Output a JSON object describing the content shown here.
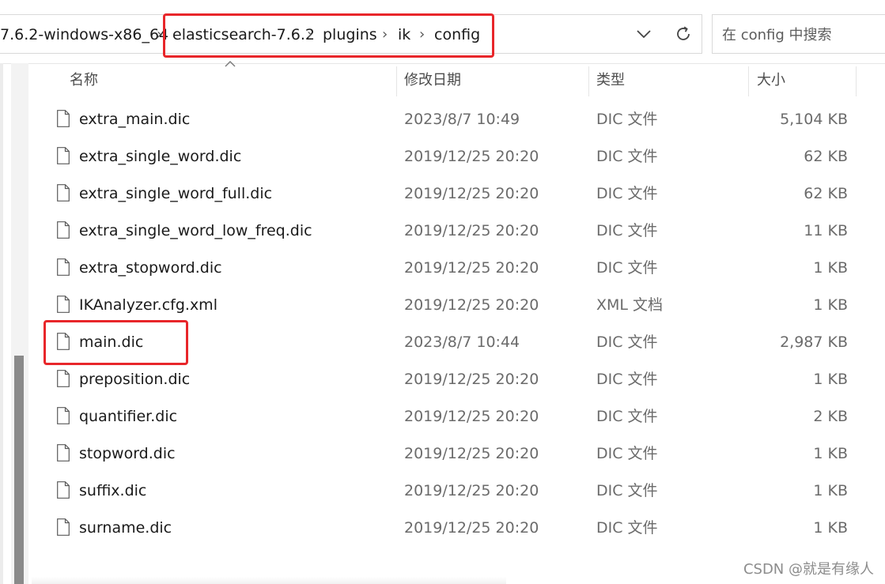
{
  "breadcrumb": {
    "items": [
      {
        "label": "7.6.2-windows-x86_64"
      },
      {
        "label": "elasticsearch-7.6.2"
      },
      {
        "label": "plugins"
      },
      {
        "label": "ik"
      },
      {
        "label": "config"
      }
    ],
    "separator": "›"
  },
  "search": {
    "placeholder": "在 config 中搜索"
  },
  "columns": {
    "name": "名称",
    "date": "修改日期",
    "type": "类型",
    "size": "大小"
  },
  "files": [
    {
      "name": "extra_main.dic",
      "date": "2023/8/7 10:49",
      "type": "DIC 文件",
      "size": "5,104 KB"
    },
    {
      "name": "extra_single_word.dic",
      "date": "2019/12/25 20:20",
      "type": "DIC 文件",
      "size": "62 KB"
    },
    {
      "name": "extra_single_word_full.dic",
      "date": "2019/12/25 20:20",
      "type": "DIC 文件",
      "size": "62 KB"
    },
    {
      "name": "extra_single_word_low_freq.dic",
      "date": "2019/12/25 20:20",
      "type": "DIC 文件",
      "size": "11 KB"
    },
    {
      "name": "extra_stopword.dic",
      "date": "2019/12/25 20:20",
      "type": "DIC 文件",
      "size": "1 KB"
    },
    {
      "name": "IKAnalyzer.cfg.xml",
      "date": "2019/12/25 20:20",
      "type": "XML 文档",
      "size": "1 KB"
    },
    {
      "name": "main.dic",
      "date": "2023/8/7 10:44",
      "type": "DIC 文件",
      "size": "2,987 KB"
    },
    {
      "name": "preposition.dic",
      "date": "2019/12/25 20:20",
      "type": "DIC 文件",
      "size": "1 KB"
    },
    {
      "name": "quantifier.dic",
      "date": "2019/12/25 20:20",
      "type": "DIC 文件",
      "size": "2 KB"
    },
    {
      "name": "stopword.dic",
      "date": "2019/12/25 20:20",
      "type": "DIC 文件",
      "size": "1 KB"
    },
    {
      "name": "suffix.dic",
      "date": "2019/12/25 20:20",
      "type": "DIC 文件",
      "size": "1 KB"
    },
    {
      "name": "surname.dic",
      "date": "2019/12/25 20:20",
      "type": "DIC 文件",
      "size": "1 KB"
    }
  ],
  "watermark": "CSDN @就是有缘人",
  "icons": {
    "dropdown": "chevron-down-icon",
    "refresh": "refresh-icon",
    "file": "file-icon",
    "sort": "sort-up-icon"
  },
  "colors": {
    "highlight": "#e8262a",
    "scroll_thumb": "#8a8a8a"
  }
}
